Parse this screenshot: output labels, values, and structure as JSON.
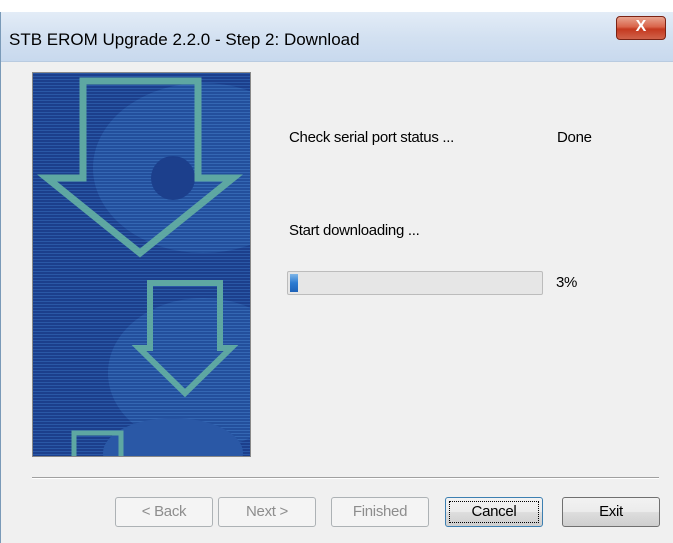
{
  "window": {
    "title": "STB EROM Upgrade 2.2.0  - Step 2: Download",
    "close_glyph": "X"
  },
  "status": {
    "check_serial_label": "Check serial port status ...",
    "check_serial_result": "Done",
    "download_label": "Start downloading ...",
    "progress_percent_text": "3%",
    "progress_value": 0.03
  },
  "buttons": {
    "back": "< Back",
    "next": "Next >",
    "finished": "Finished",
    "cancel": "Cancel",
    "exit": "Exit"
  },
  "colors": {
    "wizard_image_bg": "#1c3f8c",
    "wizard_image_arrow": "#5ea7a2",
    "progress_fill": "#2d7bd1",
    "close_button": "#c4391f"
  },
  "icons": {
    "close": "close-icon",
    "wizard_graphic": "download-arrows-graphic"
  }
}
